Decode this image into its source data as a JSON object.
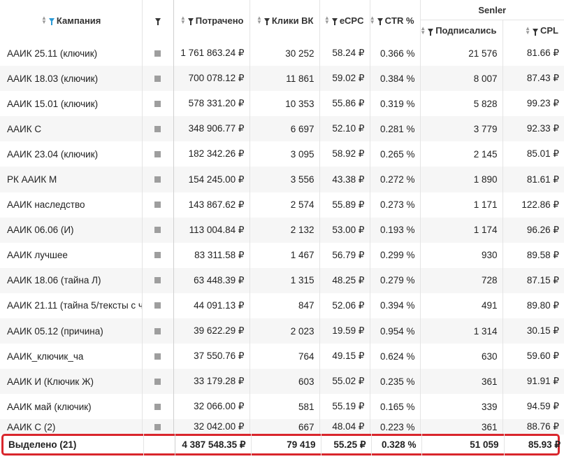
{
  "header": {
    "campaign": "Кампания",
    "spent": "Потрачено",
    "clicks": "Клики ВК",
    "ecpc": "eCPC",
    "ctr": "CTR %",
    "group": "Senler",
    "subscribed": "Подписались",
    "cpl": "CPL"
  },
  "rows": [
    {
      "name": "ААИК 25.11 (ключик)",
      "spent": "1 761 863.24 ₽",
      "clicks": "30 252",
      "ecpc": "58.24 ₽",
      "ctr": "0.366 %",
      "subs": "21 576",
      "cpl": "81.66 ₽"
    },
    {
      "name": "ААИК 18.03 (ключик)",
      "spent": "700 078.12 ₽",
      "clicks": "11 861",
      "ecpc": "59.02 ₽",
      "ctr": "0.384 %",
      "subs": "8 007",
      "cpl": "87.43 ₽"
    },
    {
      "name": "ААИК 15.01 (ключик)",
      "spent": "578 331.20 ₽",
      "clicks": "10 353",
      "ecpc": "55.86 ₽",
      "ctr": "0.319 %",
      "subs": "5 828",
      "cpl": "99.23 ₽"
    },
    {
      "name": "ААИК С",
      "spent": "348 906.77 ₽",
      "clicks": "6 697",
      "ecpc": "52.10 ₽",
      "ctr": "0.281 %",
      "subs": "3 779",
      "cpl": "92.33 ₽"
    },
    {
      "name": "ААИК 23.04 (ключик)",
      "spent": "182 342.26 ₽",
      "clicks": "3 095",
      "ecpc": "58.92 ₽",
      "ctr": "0.265 %",
      "subs": "2 145",
      "cpl": "85.01 ₽"
    },
    {
      "name": "РК ААИК М",
      "spent": "154 245.00 ₽",
      "clicks": "3 556",
      "ecpc": "43.38 ₽",
      "ctr": "0.272 %",
      "subs": "1 890",
      "cpl": "81.61 ₽"
    },
    {
      "name": "ААИК наследство",
      "spent": "143 867.62 ₽",
      "clicks": "2 574",
      "ecpc": "55.89 ₽",
      "ctr": "0.273 %",
      "subs": "1 171",
      "cpl": "122.86 ₽"
    },
    {
      "name": "ААИК 06.06 (И)",
      "spent": "113 004.84 ₽",
      "clicks": "2 132",
      "ecpc": "53.00 ₽",
      "ctr": "0.193 %",
      "subs": "1 174",
      "cpl": "96.26 ₽"
    },
    {
      "name": "ААИК лучшее",
      "spent": "83 311.58 ₽",
      "clicks": "1 467",
      "ecpc": "56.79 ₽",
      "ctr": "0.299 %",
      "subs": "930",
      "cpl": "89.58 ₽"
    },
    {
      "name": "ААИК 18.06 (тайна Л)",
      "spent": "63 448.39 ₽",
      "clicks": "1 315",
      "ecpc": "48.25 ₽",
      "ctr": "0.279 %",
      "subs": "728",
      "cpl": "87.15 ₽"
    },
    {
      "name": "ААИК 21.11 (тайна 5/тексты с ч",
      "spent": "44 091.13 ₽",
      "clicks": "847",
      "ecpc": "52.06 ₽",
      "ctr": "0.394 %",
      "subs": "491",
      "cpl": "89.80 ₽"
    },
    {
      "name": "ААИК 05.12 (причина)",
      "spent": "39 622.29 ₽",
      "clicks": "2 023",
      "ecpc": "19.59 ₽",
      "ctr": "0.954 %",
      "subs": "1 314",
      "cpl": "30.15 ₽"
    },
    {
      "name": "ААИК_ключик_ча",
      "spent": "37 550.76 ₽",
      "clicks": "764",
      "ecpc": "49.15 ₽",
      "ctr": "0.624 %",
      "subs": "630",
      "cpl": "59.60 ₽"
    },
    {
      "name": "ААИК И (Ключик Ж)",
      "spent": "33 179.28 ₽",
      "clicks": "603",
      "ecpc": "55.02 ₽",
      "ctr": "0.235 %",
      "subs": "361",
      "cpl": "91.91 ₽"
    },
    {
      "name": "ААИК май (ключик)",
      "spent": "32 066.00 ₽",
      "clicks": "581",
      "ecpc": "55.19 ₽",
      "ctr": "0.165 %",
      "subs": "339",
      "cpl": "94.59 ₽"
    },
    {
      "name": "ААИК С (2)",
      "spent": "32 042.00 ₽",
      "clicks": "667",
      "ecpc": "48.04 ₽",
      "ctr": "0.223 %",
      "subs": "361",
      "cpl": "88.76 ₽"
    }
  ],
  "total": {
    "name": "Выделено (21)",
    "spent": "4 387 548.35 ₽",
    "clicks": "79 419",
    "ecpc": "55.25 ₽",
    "ctr": "0.328 %",
    "subs": "51 059",
    "cpl": "85.93 ₽"
  },
  "colors": {
    "accent": "#2a9ad6",
    "highlight_border": "#d9262c",
    "stripe": "#f6f6f6"
  }
}
